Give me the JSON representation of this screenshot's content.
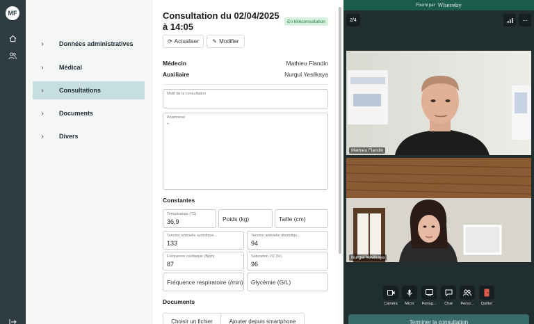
{
  "rail": {
    "avatar_initials": "MF",
    "icons": [
      "home-icon",
      "users-icon",
      "logout-icon"
    ]
  },
  "sidebar": {
    "items": [
      {
        "label": "Données administratives",
        "active": false
      },
      {
        "label": "Médical",
        "active": false
      },
      {
        "label": "Consultations",
        "active": true
      },
      {
        "label": "Documents",
        "active": false
      },
      {
        "label": "Divers",
        "active": false
      }
    ]
  },
  "consultation": {
    "title": "Consultation du 02/04/2025 à 14:05",
    "badge": "En téléconsultation",
    "refresh_label": "Actualiser",
    "edit_label": "Modifier",
    "doctor_label": "Médecin",
    "doctor_value": "Mathieu Flandin",
    "assistant_label": "Auxiliaire",
    "assistant_value": "Nurgul Yesilkaya",
    "motif_label": "Motif de la consultation",
    "motif_value": "",
    "anamnese_label": "Anamnèse",
    "anamnese_value": "-"
  },
  "constants": {
    "heading": "Constantes",
    "temperature_label": "Température (°C)",
    "temperature_value": "36,9",
    "weight_placeholder": "Poids (kg)",
    "height_placeholder": "Taille (cm)",
    "systolic_label": "Tension artérielle systolique...",
    "systolic_value": "133",
    "diastolic_label": "Tension artérielle diastoliqu...",
    "diastolic_value": "94",
    "heart_rate_label": "Fréquence cardiaque (Bpm)",
    "heart_rate_value": "87",
    "saturation_label": "Saturation O2 (%)",
    "saturation_value": "96",
    "resp_placeholder": "Fréquence respiratoire (/min)",
    "glycemia_placeholder": "Glycémie (G/L)"
  },
  "documents": {
    "heading": "Documents",
    "choose_file_label": "Choisir un fichier",
    "add_phone_label": "Ajouter depuis smartphone"
  },
  "video": {
    "provided_by": "Fourni par",
    "brand": "Whereby",
    "participant_count": "2/4",
    "participants": [
      {
        "name": "Mathieu Flandin"
      },
      {
        "name": "Nurgul Yesilkaya"
      }
    ],
    "controls": [
      {
        "label": "Caméra",
        "icon": "camera-icon"
      },
      {
        "label": "Micro",
        "icon": "microphone-icon"
      },
      {
        "label": "Partag...",
        "icon": "screen-share-icon"
      },
      {
        "label": "Chat",
        "icon": "chat-icon"
      },
      {
        "label": "Perso...",
        "icon": "people-icon"
      },
      {
        "label": "Quitter",
        "icon": "leave-icon"
      }
    ],
    "end_button": "Terminer la consultation",
    "colors": {
      "header_green": "#1b5c4a",
      "panel": "#202e30",
      "leave_red": "#e35b4a"
    }
  }
}
